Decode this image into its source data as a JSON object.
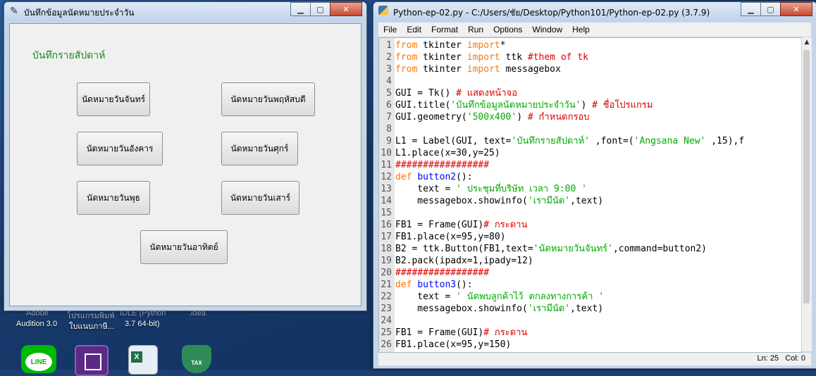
{
  "desktop": {
    "icons": [
      {
        "label1": "Adobe",
        "label2": "Audition 3.0"
      },
      {
        "label1": "โปรแกรมพิมพ์",
        "label2": "ใบแนบภาษี..."
      },
      {
        "label1": "IDLE (Python",
        "label2": "3.7 64-bit)"
      },
      {
        "label1": ".idea",
        "label2": ""
      }
    ],
    "bottom_icons": [
      {
        "name": "line-app-icon",
        "label": "LINE",
        "color": "#00b900"
      },
      {
        "name": "chip-app-icon",
        "label": "",
        "color": "#5b2a86"
      },
      {
        "name": "excel-file-icon",
        "label": "",
        "color": "#e8eef5"
      },
      {
        "name": "tax-app-icon",
        "label": "TAX",
        "color": "#2e8b57"
      }
    ]
  },
  "tk_window": {
    "title": "บันทึกข้อมูลนัดหมายประจำวัน",
    "label": "บันทึกรายสัปดาห์",
    "buttons": {
      "mon": "นัดหมายวันจันทร์",
      "thu": "นัดหมายวันพฤหัสบดี",
      "tue": "นัดหมายวันอังคาร",
      "fri": "นัดหมายวันศุกร์",
      "wed": "นัดหมายวันพุธ",
      "sat": "นัดหมายวันเสาร์",
      "sun": "นัดหมายวันอาทิตย์"
    }
  },
  "idle_window": {
    "title": "Python-ep-02.py - C:/Users/ชัย/Desktop/Python101/Python-ep-02.py (3.7.9)",
    "menu": [
      "File",
      "Edit",
      "Format",
      "Run",
      "Options",
      "Window",
      "Help"
    ],
    "status": "Ln: 25   Col: 0",
    "code_lines": [
      [
        {
          "t": "from",
          "c": "kw"
        },
        {
          "t": " tkinter "
        },
        {
          "t": "import",
          "c": "kw"
        },
        {
          "t": "*"
        }
      ],
      [
        {
          "t": "from",
          "c": "kw"
        },
        {
          "t": " tkinter "
        },
        {
          "t": "import",
          "c": "kw"
        },
        {
          "t": " ttk "
        },
        {
          "t": "#them of tk",
          "c": "com"
        }
      ],
      [
        {
          "t": "from",
          "c": "kw"
        },
        {
          "t": " tkinter "
        },
        {
          "t": "import",
          "c": "kw"
        },
        {
          "t": " messagebox"
        }
      ],
      [],
      [
        {
          "t": "GUI = Tk() "
        },
        {
          "t": "# แสดงหน้าจอ",
          "c": "com"
        }
      ],
      [
        {
          "t": "GUI.title("
        },
        {
          "t": "'บันทึกข้อมูลนัดหมายประจำวัน'",
          "c": "str"
        },
        {
          "t": ") "
        },
        {
          "t": "# ชื่อโปรแกรม",
          "c": "com"
        }
      ],
      [
        {
          "t": "GUI.geometry("
        },
        {
          "t": "'500x400'",
          "c": "str"
        },
        {
          "t": ") "
        },
        {
          "t": "# กำหนดกรอบ",
          "c": "com"
        }
      ],
      [],
      [
        {
          "t": "L1 = Label(GUI, text="
        },
        {
          "t": "'บันทึกรายสัปดาห์'",
          "c": "str"
        },
        {
          "t": " ,font=("
        },
        {
          "t": "'Angsana New'",
          "c": "str"
        },
        {
          "t": " ,15),f"
        }
      ],
      [
        {
          "t": "L1.place(x=30,y=25)"
        }
      ],
      [
        {
          "t": "#################",
          "c": "com"
        }
      ],
      [
        {
          "t": "def",
          "c": "kw"
        },
        {
          "t": " "
        },
        {
          "t": "button2",
          "c": "def"
        },
        {
          "t": "():"
        }
      ],
      [
        {
          "t": "    text = "
        },
        {
          "t": "' ประชุมที่บริษัท เวลา 9:00 '",
          "c": "str"
        }
      ],
      [
        {
          "t": "    messagebox.showinfo("
        },
        {
          "t": "'เรามีนัด'",
          "c": "str"
        },
        {
          "t": ",text)"
        }
      ],
      [],
      [
        {
          "t": "FB1 = Frame(GUI)"
        },
        {
          "t": "# กระดาน",
          "c": "com"
        }
      ],
      [
        {
          "t": "FB1.place(x=95,y=80)"
        }
      ],
      [
        {
          "t": "B2 = ttk.Button(FB1,text="
        },
        {
          "t": "'นัดหมายวันจันทร์'",
          "c": "str"
        },
        {
          "t": ",command=button2)"
        }
      ],
      [
        {
          "t": "B2.pack(ipadx=1,ipady=12)"
        }
      ],
      [
        {
          "t": "#################",
          "c": "com"
        }
      ],
      [
        {
          "t": "def",
          "c": "kw"
        },
        {
          "t": " "
        },
        {
          "t": "button3",
          "c": "def"
        },
        {
          "t": "():"
        }
      ],
      [
        {
          "t": "    text = "
        },
        {
          "t": "' นัดพบลูกค้าไว้ ตกลงทางการค้า '",
          "c": "str"
        }
      ],
      [
        {
          "t": "    messagebox.showinfo("
        },
        {
          "t": "'เรามีนัด'",
          "c": "str"
        },
        {
          "t": ",text)"
        }
      ],
      [],
      [
        {
          "t": "FB1 = Frame(GUI)"
        },
        {
          "t": "# กระดาน",
          "c": "com"
        }
      ],
      [
        {
          "t": "FB1.place(x=95,y=150)"
        }
      ]
    ]
  }
}
